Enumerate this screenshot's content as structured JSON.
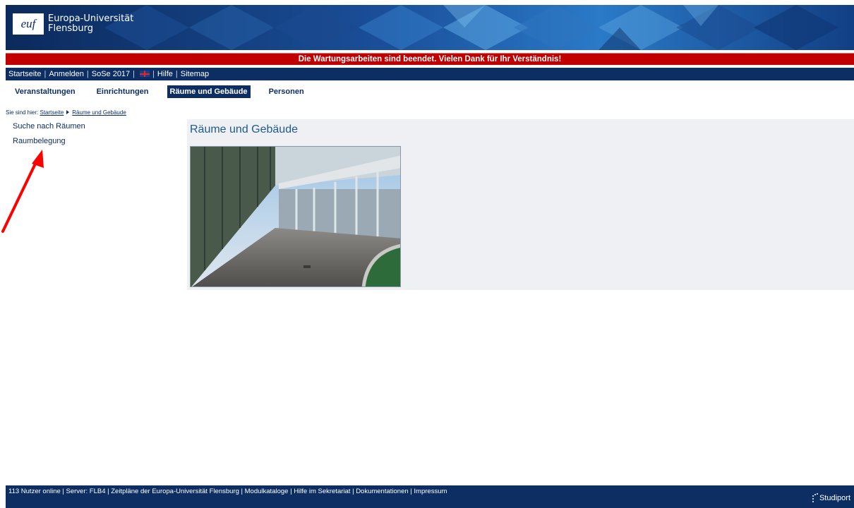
{
  "header": {
    "logo_mark": "euf",
    "logo_line1": "Europa-Universität",
    "logo_line2": "Flensburg",
    "colors": {
      "brand": "#0d2e63",
      "banner_red": "#c00000",
      "content_bg": "#eff0f3",
      "annotation": "#ff0000"
    }
  },
  "maintenance_banner": "Die Wartungsarbeiten sind beendet. Vielen Dank für Ihr Verständnis!",
  "top_nav": {
    "home": "Startseite",
    "login": "Anmelden",
    "semester": "SoSe 2017",
    "language_icon": "uk-flag-icon",
    "help": "Hilfe",
    "sitemap": "Sitemap",
    "separator": "|"
  },
  "main_nav": [
    {
      "label": "Veranstaltungen"
    },
    {
      "label": "Einrichtungen"
    },
    {
      "label": "Räume und Gebäude",
      "active": true
    },
    {
      "label": "Personen"
    }
  ],
  "breadcrumb": {
    "prefix": "Sie sind hier:",
    "home": "Startseite",
    "current": "Räume und Gebäude"
  },
  "sidebar": [
    {
      "label": "Suche nach Räumen"
    },
    {
      "label": "Raumbelegung"
    }
  ],
  "content": {
    "title": "Räume und Gebäude",
    "image": "campus-building-photo"
  },
  "footer": {
    "users_online": "113 Nutzer online",
    "server": "Server: FLB4",
    "schedules": "Zeitpläne der Europa-Universität Flensburg",
    "module_catalogs": "Modulkataloge",
    "secretariat_help": "Hilfe im Sekretariat",
    "documentation": "Dokumentationen",
    "imprint": "Impressum",
    "separator": "|",
    "brand": "Studiport"
  }
}
